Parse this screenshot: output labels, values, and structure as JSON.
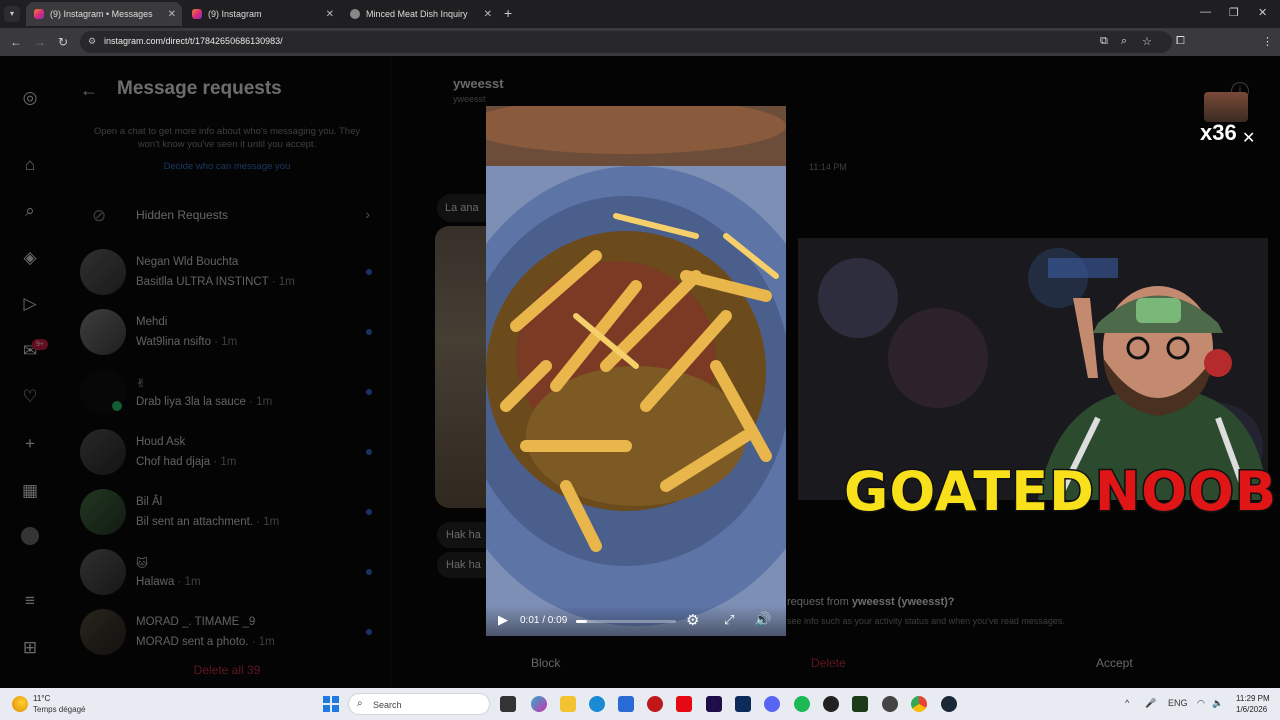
{
  "browser": {
    "tabs": [
      {
        "title": "(9) Instagram • Messages",
        "active": true
      },
      {
        "title": "(9) Instagram",
        "active": false
      },
      {
        "title": "Minced Meat Dish Inquiry",
        "active": false
      }
    ],
    "url": "instagram.com/direct/t/17842650686130983/"
  },
  "requests": {
    "title": "Message requests",
    "info": "Open a chat to get more info about who's messaging you. They won't know you've seen it until you accept.",
    "link": "Decide who can message you",
    "hidden_label": "Hidden Requests",
    "chats": [
      {
        "name": "Negan Wld Bouchta",
        "message": "Basitlla ULTRA INSTINCT",
        "time": " · 1m"
      },
      {
        "name": "Mehdi",
        "message": "Wat9lina nsifto",
        "time": " · 1m"
      },
      {
        "name": "✌",
        "message": "Drab liya 3la la sauce",
        "time": " · 1m"
      },
      {
        "name": "Houd Ask",
        "message": "Chof had djaja",
        "time": " · 1m"
      },
      {
        "name": "Bil Âl",
        "message": "Bil sent an attachment.",
        "time": " · 1m"
      },
      {
        "name": "🐱",
        "message": "Halawa",
        "time": " · 1m"
      },
      {
        "name": "MORAD _. TIMAME _9",
        "message": "MORAD sent a photo.",
        "time": " · 1m"
      }
    ],
    "delete_all": "Delete all 39"
  },
  "nav": {
    "badge": "9+"
  },
  "conversation": {
    "username": "yweesst",
    "handle": "yweesst",
    "time": "11:14 PM",
    "bubble1": "La ana",
    "bubble2": "Hak ha",
    "bubble3": "Hak ha",
    "accept_question_prefix": "request from ",
    "accept_question_user": "yweesst (yweesst)?",
    "accept_sub": "see info such as your activity status and when you've read messages.",
    "block": "Block",
    "delete": "Delete",
    "accept": "Accept"
  },
  "video": {
    "time": "0:01 / 0:09",
    "progress": 0.11
  },
  "overlay": {
    "brand_a": "GOATED",
    "brand_b": "NOOBIE",
    "counter": "x36"
  },
  "taskbar": {
    "temp": "11°C",
    "weather": "Temps dégagé",
    "search_placeholder": "Search",
    "lang": "ENG",
    "time": "11:29 PM",
    "date": "1/6/2026"
  },
  "colors": {
    "accent_blue": "#3a6fd8",
    "danger": "#d33045",
    "brand_yellow": "#f8e11a",
    "brand_red": "#e01616"
  }
}
